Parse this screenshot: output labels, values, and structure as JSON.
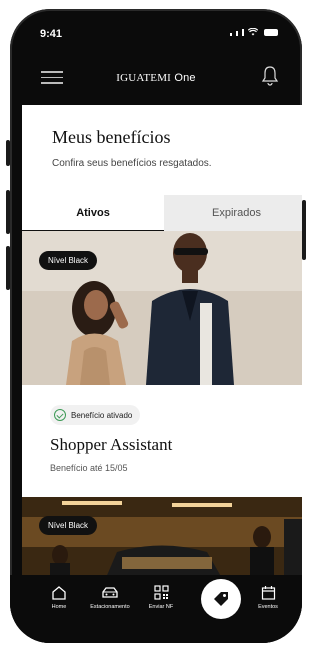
{
  "status_bar": {
    "time": "9:41"
  },
  "header": {
    "brand_part1": "IGUATEMI",
    "brand_part2": "One"
  },
  "page": {
    "title": "Meus benefícios",
    "subtitle": "Confira seus benefícios resgatados."
  },
  "tabs": [
    {
      "label": "Ativos",
      "active": true
    },
    {
      "label": "Expirados",
      "active": false
    }
  ],
  "cards": [
    {
      "badge": "Nível Black",
      "status": "Benefício ativado",
      "title": "Shopper Assistant",
      "validity": "Benefício até 15/05"
    },
    {
      "badge": "Nível Black"
    }
  ],
  "bottom_nav": [
    {
      "label": "Home",
      "icon": "home-icon"
    },
    {
      "label": "Estacionamento",
      "icon": "car-icon"
    },
    {
      "label": "Enviar NF",
      "icon": "qr-icon"
    },
    {
      "label": "",
      "icon": "tag-icon"
    },
    {
      "label": "Eventos",
      "icon": "calendar-icon"
    }
  ],
  "colors": {
    "dark": "#0b0b0b",
    "success": "#3d9a56",
    "tab_inactive": "#ececec"
  }
}
